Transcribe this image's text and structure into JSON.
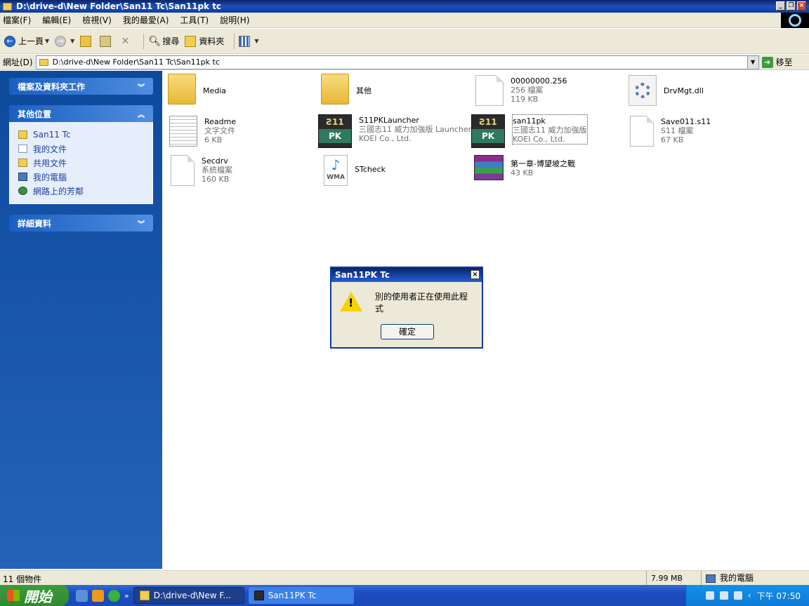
{
  "window": {
    "title": "D:\\drive-d\\New Folder\\San11 Tc\\San11pk tc"
  },
  "menu": [
    "檔案(F)",
    "編輯(E)",
    "檢視(V)",
    "我的最愛(A)",
    "工具(T)",
    "說明(H)"
  ],
  "toolbar": {
    "back": "上一頁",
    "search": "搜尋",
    "folders": "資料夾"
  },
  "address": {
    "label": "網址(D)",
    "path": "D:\\drive-d\\New Folder\\San11 Tc\\San11pk tc",
    "go": "移至"
  },
  "taskpane": {
    "file_tasks": "檔案及資料夾工作",
    "other_places": "其他位置",
    "places": [
      "San11 Tc",
      "我的文件",
      "共用文件",
      "我的電腦",
      "網路上的芳鄰"
    ],
    "details": "詳細資料"
  },
  "files": [
    {
      "name": "Media",
      "line2": "",
      "line3": "",
      "icon": "folder-icon"
    },
    {
      "name": "其他",
      "line2": "",
      "line3": "",
      "icon": "folder-icon"
    },
    {
      "name": "00000000.256",
      "line2": "256 檔案",
      "line3": "119 KB",
      "icon": "file-icon"
    },
    {
      "name": "DrvMgt.dll",
      "line2": "",
      "line3": "",
      "icon": "dll-icon"
    },
    {
      "name": "Readme",
      "line2": "文字文件",
      "line3": "6 KB",
      "icon": "text-file-icon"
    },
    {
      "name": "S11PKLauncher",
      "line2": "三國志11 威力加強版 Launcher",
      "line3": "KOEI Co., Ltd.",
      "icon": "san11pk-icon"
    },
    {
      "name": "san11pk",
      "line2": "三國志11 威力加強版",
      "line3": "KOEI Co., Ltd.",
      "icon": "san11pk-icon"
    },
    {
      "name": "Save011.s11",
      "line2": "S11 檔案",
      "line3": "67 KB",
      "icon": "file-icon"
    },
    {
      "name": "Secdrv",
      "line2": "系統檔案",
      "line3": "160 KB",
      "icon": "file-icon"
    },
    {
      "name": "STcheck",
      "line2": "",
      "line3": "",
      "icon": "wma-icon"
    },
    {
      "name": "第一章-博望坡之戰",
      "line2": "43 KB",
      "line3": "",
      "icon": "rar-icon"
    }
  ],
  "dialog": {
    "title": "San11PK Tc",
    "message": "別的使用者正在使用此程式",
    "ok": "確定",
    "close": "×"
  },
  "status": {
    "count": "11 個物件",
    "size": "7.99 MB",
    "location": "我的電腦"
  },
  "taskbar": {
    "start": "開始",
    "tasks": [
      "D:\\drive-d\\New F...",
      "San11PK Tc"
    ],
    "clock": "下午 07:50"
  }
}
